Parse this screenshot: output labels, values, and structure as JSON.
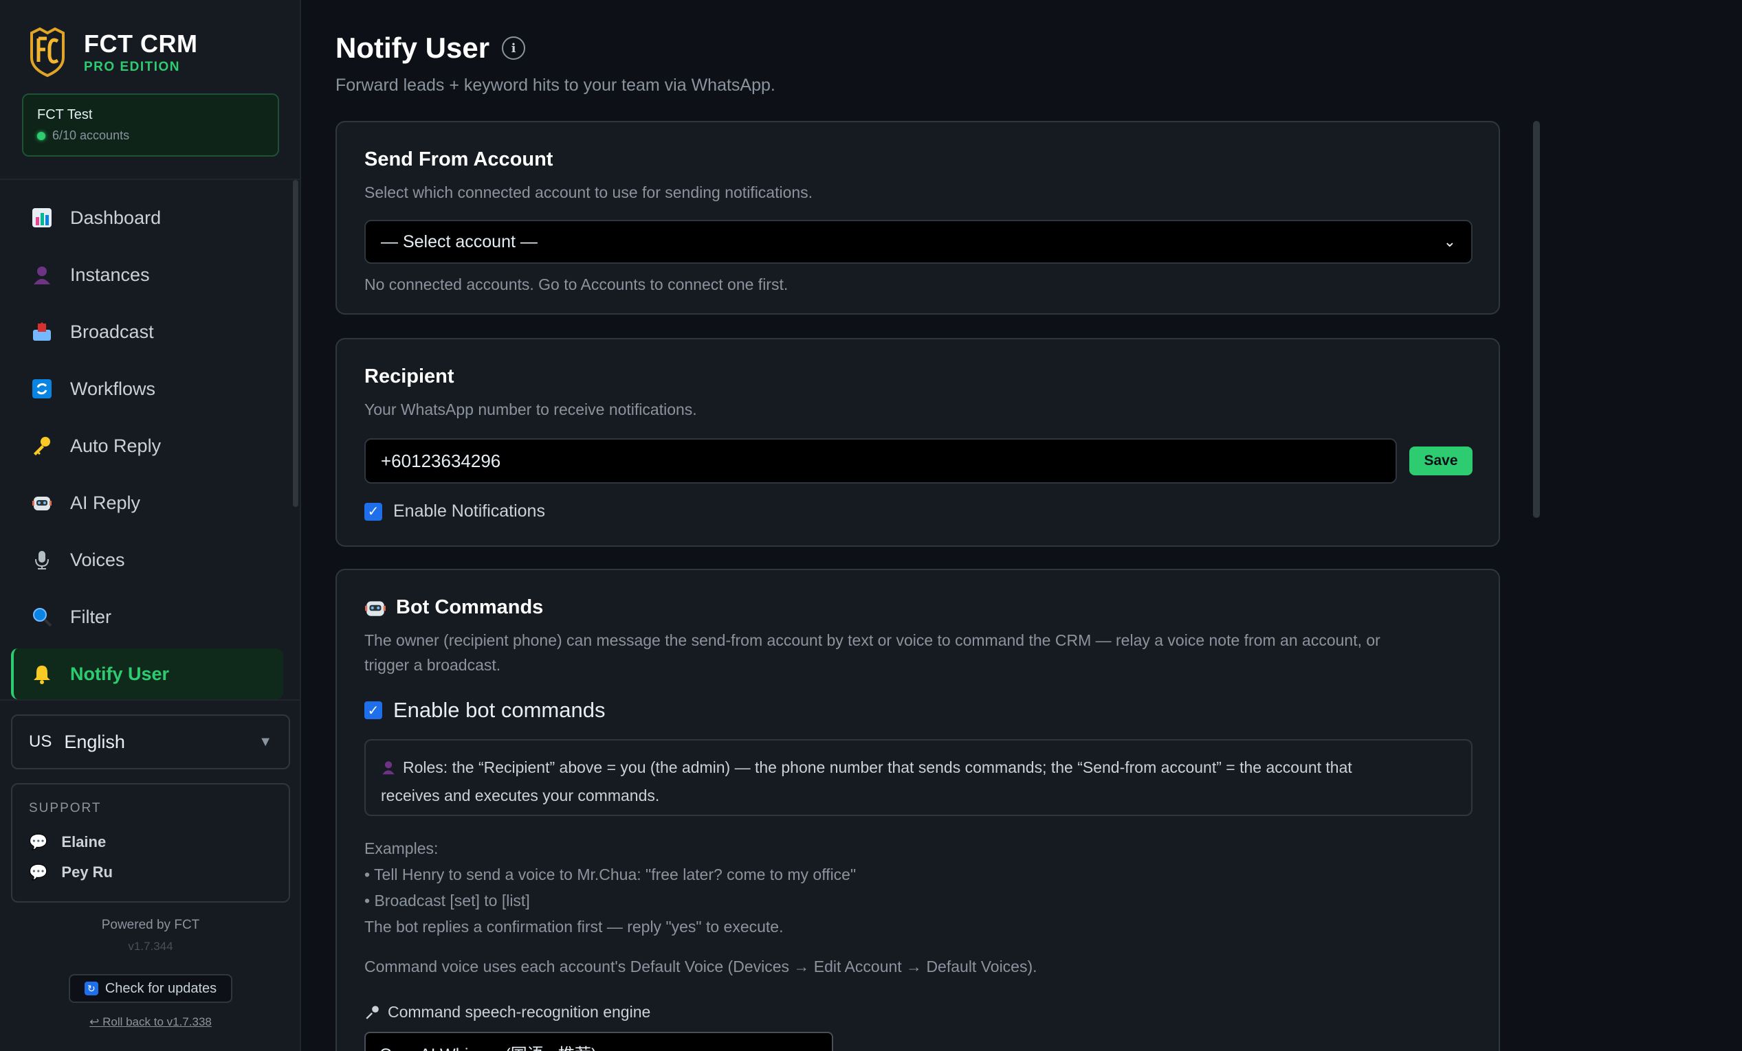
{
  "brand": {
    "title": "FCT CRM",
    "subtitle": "PRO EDITION"
  },
  "org": {
    "name": "FCT Test",
    "accounts": "6/10 accounts"
  },
  "nav": {
    "items": [
      {
        "label": "Dashboard",
        "icon": "bar-chart-icon"
      },
      {
        "label": "Instances",
        "icon": "user-silhouette-icon"
      },
      {
        "label": "Broadcast",
        "icon": "outbox-tray-icon"
      },
      {
        "label": "Workflows",
        "icon": "refresh-arrows-icon"
      },
      {
        "label": "Auto Reply",
        "icon": "key-icon"
      },
      {
        "label": "AI Reply",
        "icon": "robot-icon"
      },
      {
        "label": "Voices",
        "icon": "microphone-icon"
      },
      {
        "label": "Filter",
        "icon": "magnifier-icon"
      },
      {
        "label": "Notify User",
        "icon": "bell-icon",
        "active": true
      }
    ]
  },
  "language": {
    "flag": "US",
    "label": "English"
  },
  "support": {
    "title": "SUPPORT",
    "contacts": [
      "Elaine",
      "Pey Ru"
    ]
  },
  "footer": {
    "powered": "Powered by FCT",
    "version": "v1.7.344",
    "update_label": "Check for updates",
    "rollback_label": "↩ Roll back to v1.7.338"
  },
  "page": {
    "title": "Notify User",
    "subtitle": "Forward leads + keyword hits to your team via WhatsApp."
  },
  "send_from": {
    "title": "Send From Account",
    "description": "Select which connected account to use for sending notifications.",
    "selected": "— Select account —",
    "hint": "No connected accounts. Go to Accounts to connect one first."
  },
  "recipient": {
    "title": "Recipient",
    "description": "Your WhatsApp number to receive notifications.",
    "phone": "+60123634296",
    "save_label": "Save",
    "enable_label": "Enable Notifications",
    "enabled": true
  },
  "bot": {
    "title": "Bot Commands",
    "description_1": "The owner (recipient phone) can message the send-from account by text or voice to command the CRM — relay a voice note from an account, or",
    "description_2": "trigger a broadcast.",
    "enable_label": "Enable bot commands",
    "enabled": true,
    "roles_1": "Roles: the “Recipient” above = you (the admin) — the phone number that sends commands; the “Send-from account” = the account that",
    "roles_2": "receives and executes your commands.",
    "examples_title": "Examples:",
    "example_1": "• Tell Henry to send a voice to Mr.Chua: \"free later? come to my office\"",
    "example_2": "• Broadcast [set] to [list]",
    "confirm_note": "The bot replies a confirmation first — reply \"yes\" to execute.",
    "voice_note": "Command voice uses each account's Default Voice (Devices → Edit Account → Default Voices).",
    "engine_label": "Command speech-recognition engine",
    "engine_value": "OpenAI Whisper (国语 · 推荐)"
  },
  "colors": {
    "accent": "#2ecc71",
    "background": "#0d1117",
    "card": "#161b22",
    "checkbox": "#1f6feb"
  }
}
